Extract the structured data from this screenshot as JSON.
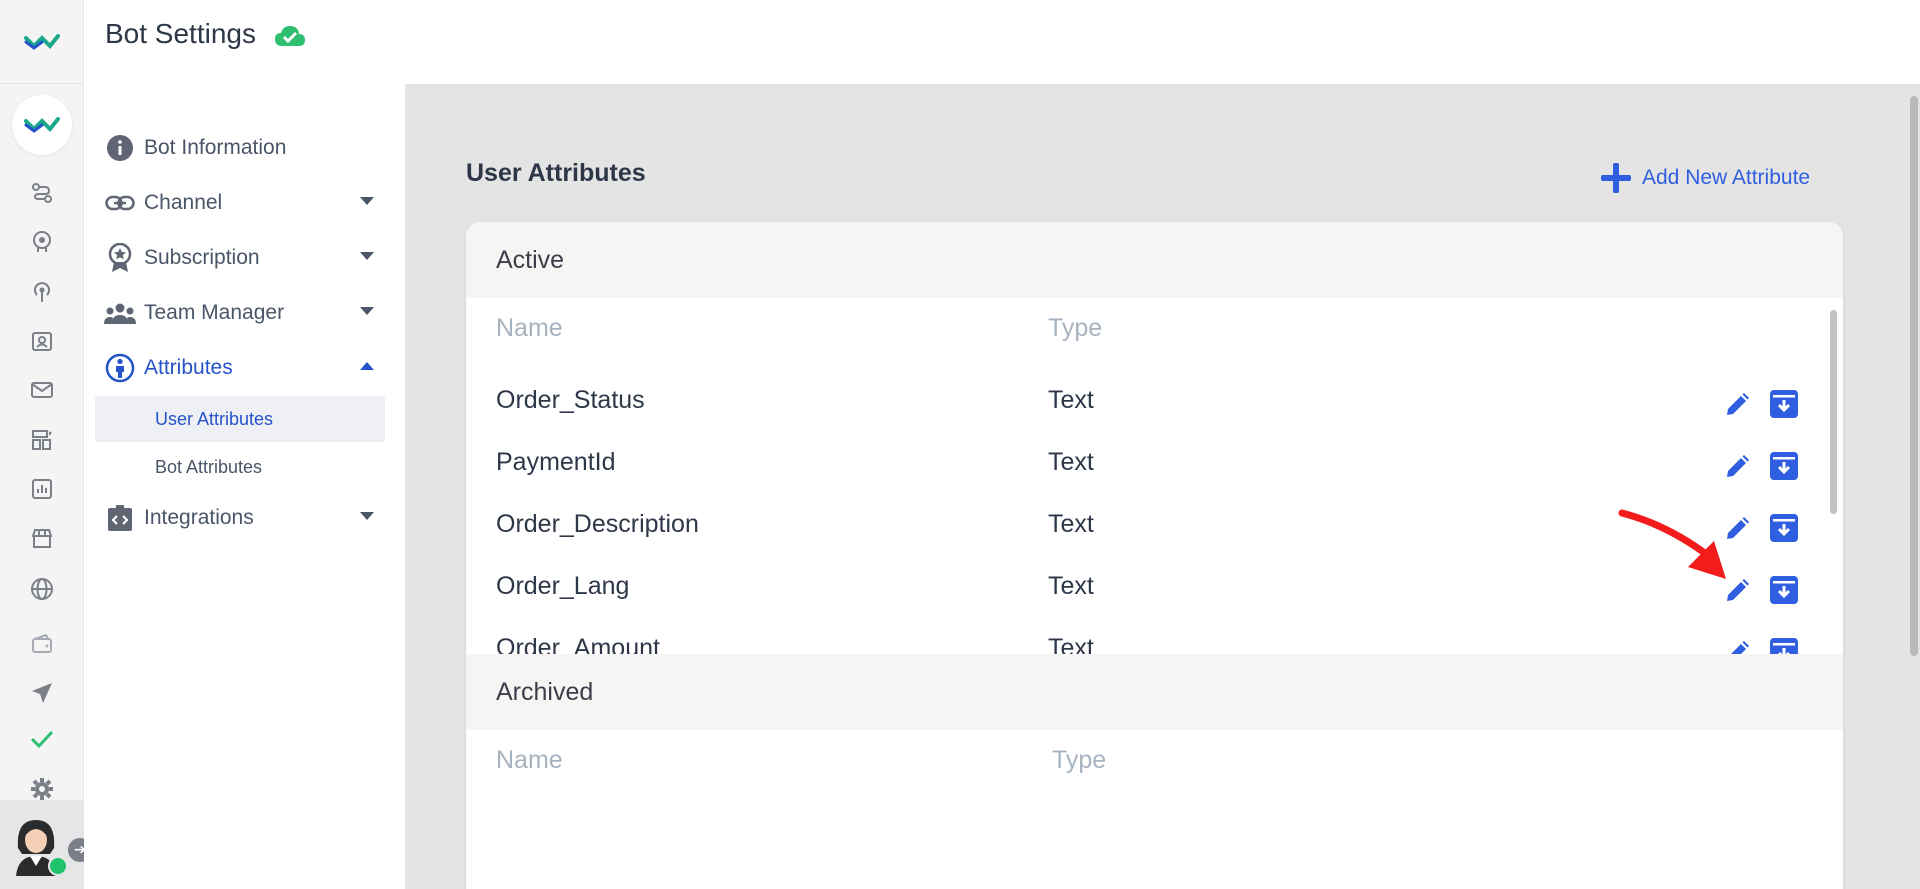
{
  "header": {
    "title": "Bot Settings",
    "status_icon": "cloud-check-icon",
    "status_color": "#2fbf71"
  },
  "rail": {
    "icons": [
      "logo-icon",
      "bot-avatar-icon",
      "flow-icon",
      "brain-icon",
      "broadcast-icon",
      "contacts-icon",
      "mail-icon",
      "dashboard-icon",
      "analytics-icon",
      "store-icon",
      "globe-icon",
      "wallet-icon",
      "send-icon",
      "check-icon",
      "gear-icon"
    ],
    "user_status": "online"
  },
  "settings_nav": {
    "items": [
      {
        "label": "Bot Information",
        "icon": "info-icon"
      },
      {
        "label": "Channel",
        "icon": "link-icon"
      },
      {
        "label": "Subscription",
        "icon": "badge-icon"
      },
      {
        "label": "Team Manager",
        "icon": "team-icon"
      },
      {
        "label": "Attributes",
        "icon": "person-icon"
      },
      {
        "label": "Integrations",
        "icon": "code-icon"
      }
    ],
    "sub_items": [
      {
        "label": "User Attributes"
      },
      {
        "label": "Bot Attributes"
      }
    ]
  },
  "main": {
    "title": "User Attributes",
    "add_button_label": "Add New Attribute",
    "active": {
      "heading": "Active",
      "col_name": "Name",
      "col_type": "Type",
      "rows": [
        {
          "name": "Order_Status",
          "type": "Text"
        },
        {
          "name": "PaymentId",
          "type": "Text"
        },
        {
          "name": "Order_Description",
          "type": "Text"
        },
        {
          "name": "Order_Lang",
          "type": "Text"
        },
        {
          "name": "Order_Amount",
          "type": "Text"
        }
      ]
    },
    "archived": {
      "heading": "Archived",
      "col_name": "Name",
      "col_type": "Type"
    }
  },
  "colors": {
    "accent": "#2f5fe0",
    "active_nav": "#2553c8",
    "annotation": "#f21c1c"
  }
}
